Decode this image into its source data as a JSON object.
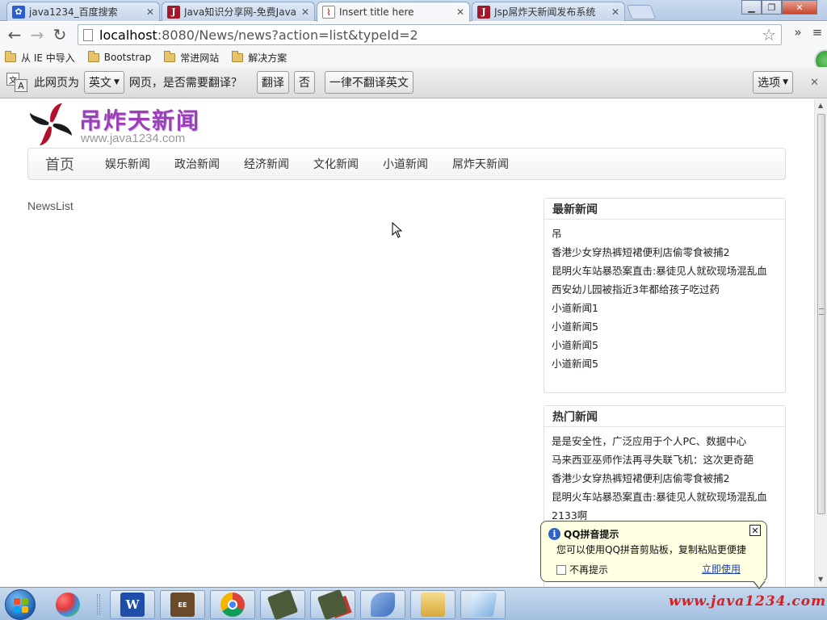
{
  "browser": {
    "tabs": [
      {
        "title": "java1234_百度搜索",
        "favicon": "baidu-paw-icon",
        "active": false
      },
      {
        "title": "Java知识分享网-免费Java",
        "favicon": "java1234-j-icon",
        "active": false
      },
      {
        "title": "Insert title here",
        "favicon": "page-icon",
        "active": true
      },
      {
        "title": "Jsp屌炸天新闻发布系统",
        "favicon": "java1234-j-icon",
        "active": false
      }
    ],
    "url_host": "localhost",
    "url_rest": ":8080/News/news?action=list&typeId=2",
    "bookmarks": [
      "从 IE 中导入",
      "Bootstrap",
      "常进网站",
      "解决方案"
    ]
  },
  "translate_bar": {
    "prefix": "此网页为",
    "language": "英文",
    "question": "网页，是否需要翻译？",
    "translate_label": "翻译",
    "no_label": "否",
    "never_label": "一律不翻译英文",
    "options_label": "选项"
  },
  "site": {
    "logo_name": "吊炸天新闻",
    "logo_domain": "www.java1234.com",
    "nav": {
      "brand": "首页",
      "items": [
        "娱乐新闻",
        "政治新闻",
        "经济新闻",
        "文化新闻",
        "小道新闻",
        "屌炸天新闻"
      ]
    },
    "newslist_title": "NewsList",
    "latest": {
      "title": "最新新闻",
      "items": [
        "吊",
        "香港少女穿热裤短裙便利店偷零食被捕2",
        "昆明火车站暴恐案直击:暴徒见人就砍现场混乱血",
        "西安幼儿园被指近3年都给孩子吃过药",
        "小道新闻1",
        "小道新闻5",
        "小道新闻5",
        "小道新闻5"
      ]
    },
    "hot": {
      "title": "热门新闻",
      "items": [
        "是是安全性，广泛应用于个人PC、数据中心",
        "马来西亚巫师作法再寻失联飞机：这次更奇葩",
        "香港少女穿热裤短裙便利店偷零食被捕2",
        "昆明火车站暴恐案直击:暴徒见人就砍现场混乱血",
        "2133啊"
      ]
    }
  },
  "qq_tip": {
    "title": "QQ拼音提示",
    "body": "您可以使用QQ拼音剪贴板，复制粘贴更便捷",
    "checkbox_label": "不再提示",
    "link_label": "立即使用"
  },
  "taskbar": {
    "apps": [
      "windows-logo-icon",
      "word-w-icon",
      "java-ee-ide-icon",
      "chrome-icon",
      "app-icon",
      "app-icon",
      "dolphin-icon",
      "explorer-folder-icon",
      "app-icon"
    ],
    "watermark": "www.java1234.com"
  },
  "colors": {
    "logo_purple": "#9b3fb8",
    "watermark_red": "#d42020",
    "tooltip_bg": "#ffffe1"
  }
}
